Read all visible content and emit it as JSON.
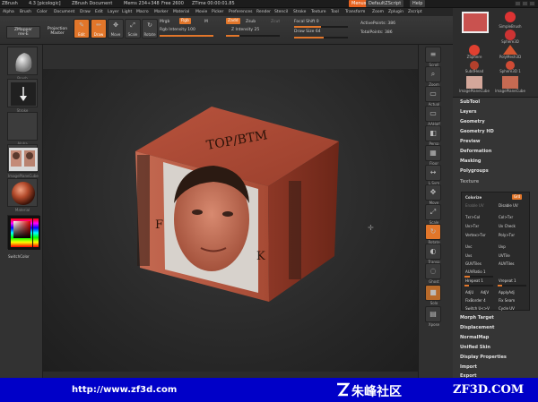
{
  "titlebar": {
    "items": [
      "ZBrush",
      "4.3 [picologic]",
      "ZBrush Document",
      "Mems 234+348",
      "Free 2600",
      "ZTime 00:00:01.85"
    ],
    "menus_btn": "Menus",
    "script_btn": "DefaultZScript",
    "help_btn": "Help"
  },
  "menubar": [
    "Alpha",
    "Brush",
    "Color",
    "Document",
    "Draw",
    "Edit",
    "Layer",
    "Light",
    "Macro",
    "Marker",
    "Material",
    "Movie",
    "Picker",
    "Preferences",
    "Render",
    "Stencil",
    "Stroke",
    "Texture",
    "Tool",
    "Transform",
    "Zoom",
    "Zplugin",
    "Zscript"
  ],
  "toolbar": {
    "zmapper": "ZMapper",
    "zmapper_sub": "rev-E",
    "projection": "Projection",
    "master": "Master",
    "buttons": [
      {
        "label": "Edit",
        "glyph": "✎"
      },
      {
        "label": "Draw",
        "glyph": "✏"
      },
      {
        "label": "Move",
        "glyph": "✥"
      },
      {
        "label": "Scale",
        "glyph": "⤢"
      },
      {
        "label": "Rotate",
        "glyph": "↻"
      }
    ],
    "mrgb": "Mrgb",
    "rgb": "Rgb",
    "m": "M",
    "rgb_intensity": "Rgb Intensity 100",
    "zadd": "Zadd",
    "zsub": "Zsub",
    "zcut": "Zcut",
    "z_intensity": "Z Intensity 25",
    "focal_shift": "Focal Shift 0",
    "draw_size": "Draw Size 64",
    "active_points": "ActivePoints: 386",
    "total_points": "TotalPoints: 386"
  },
  "left": {
    "thumbs": [
      "Brush",
      "Stroke",
      "Alpha",
      "Texture",
      "Material"
    ],
    "switch_color": "SwitchColor",
    "texture_label": "ImagePlaneCube"
  },
  "viewport": {
    "top_face": "TOP/BTM",
    "left_face": "F",
    "right_face": "K"
  },
  "shelf": [
    "Scroll",
    "Zoom",
    "Actual",
    "AAHalf",
    "Persp",
    "Floor",
    "L.Sym",
    "Move",
    "Scale",
    "Rotate",
    "Transp",
    "Ghost",
    "Solo",
    "Xpose"
  ],
  "right": {
    "thumb_labels": [
      "SimpleBrush",
      "Sphere3D",
      "ZSphere",
      "PolyMesh3D",
      "SubdHead",
      "Sphere3D 1",
      "ImagePlaneCube",
      "ImagePlaneCube"
    ],
    "panels_top": [
      "SubTool",
      "Layers",
      "Geometry",
      "Geometry HD",
      "Preview",
      "Deformation",
      "Masking",
      "Polygroups"
    ],
    "texture": "Texture",
    "texture_items": [
      [
        "Colorize",
        "Grd"
      ],
      [
        "Enable UV",
        "Disable UV"
      ],
      [
        "Txr>Col",
        "Col>Txr"
      ],
      [
        "Uv>Txr",
        "Uv Check"
      ],
      [
        "Vertex>Txr",
        "Poly>Txr"
      ],
      [
        "Uvc",
        "Uvp"
      ],
      [
        "Uvs",
        "UVTile"
      ],
      [
        "GUVTiles",
        "AUVTiles"
      ],
      [
        "AUVRatio 1",
        ""
      ],
      [
        "Hrepeat 1",
        "Vrepeat 1"
      ],
      [
        "AdjU",
        "AdjV",
        "ApplyAdj"
      ],
      [
        "FixBorder 4",
        "Fix Seam"
      ],
      [
        "Switch U<>V",
        "Cycle UV"
      ]
    ],
    "panels_bottom": [
      "Morph Target",
      "Displacement",
      "NormalMap",
      "Unified Skin",
      "Display Properties",
      "Import",
      "Export"
    ]
  },
  "footer": {
    "url": "http://www.zf3d.com",
    "cn": "朱峰社区",
    "brand": "ZF3D.COM"
  },
  "colors": {
    "accent": "#e2762a",
    "footer": "#0000c8",
    "cube": "#b4553e"
  }
}
